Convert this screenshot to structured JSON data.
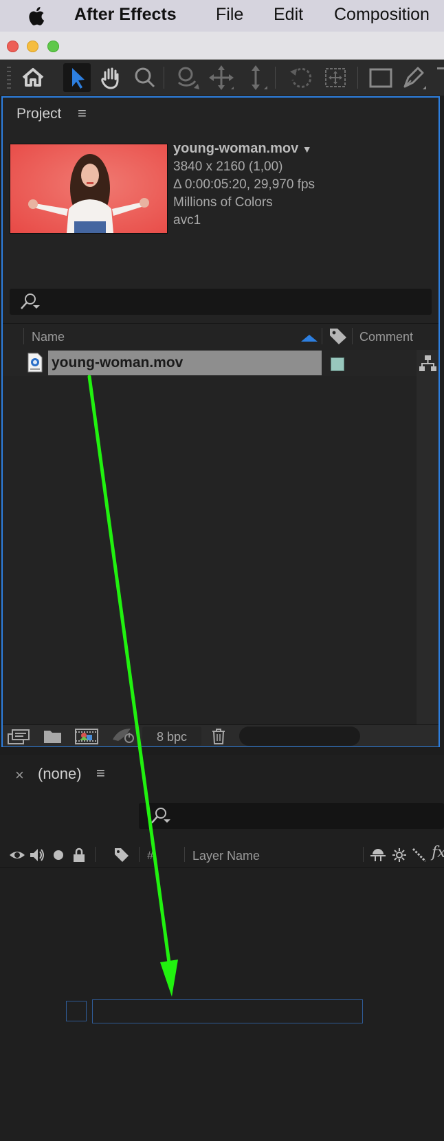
{
  "menubar": {
    "apple_icon": "apple-logo-icon",
    "app_name": "After Effects",
    "items": [
      "File",
      "Edit",
      "Composition"
    ]
  },
  "window": {
    "traffic_lights": [
      "close",
      "minimize",
      "zoom"
    ],
    "traffic_light_colors": [
      "#ed5f57",
      "#f5bd3f",
      "#5fc84a"
    ]
  },
  "toolbar": {
    "tools": [
      "home-icon",
      "selection-tool-icon",
      "hand-tool-icon",
      "zoom-tool-icon",
      "orbit-camera-icon",
      "pan-camera-icon",
      "dolly-camera-icon",
      "rotation-tool-icon",
      "pan-behind-icon",
      "rectangle-tool-icon",
      "pen-tool-icon"
    ],
    "active_tool": "selection-tool-icon",
    "accent_color": "#2d7fe0"
  },
  "project_panel": {
    "tab_label": "Project",
    "menu_icon": "hamburger-icon",
    "preview": {
      "name": "young-woman.mov",
      "dimensions": "3840 x 2160 (1,00)",
      "duration": "Δ 0:00:05:20, 29,970 fps",
      "colors": "Millions of Colors",
      "codec": "avc1"
    },
    "search": {
      "placeholder": ""
    },
    "columns": {
      "name": "Name",
      "comment": "Comment"
    },
    "items": [
      {
        "name": "young-woman.mov",
        "selected": true,
        "label_color": "#98c7bd"
      }
    ],
    "footer": {
      "bpc": "8 bpc"
    }
  },
  "timeline_panel": {
    "close_symbol": "×",
    "title": "(none)",
    "menu_icon": "hamburger-icon",
    "columns": {
      "hash": "#",
      "layer_name": "Layer Name"
    }
  },
  "annotation": {
    "arrow_color": "#21f10f"
  }
}
